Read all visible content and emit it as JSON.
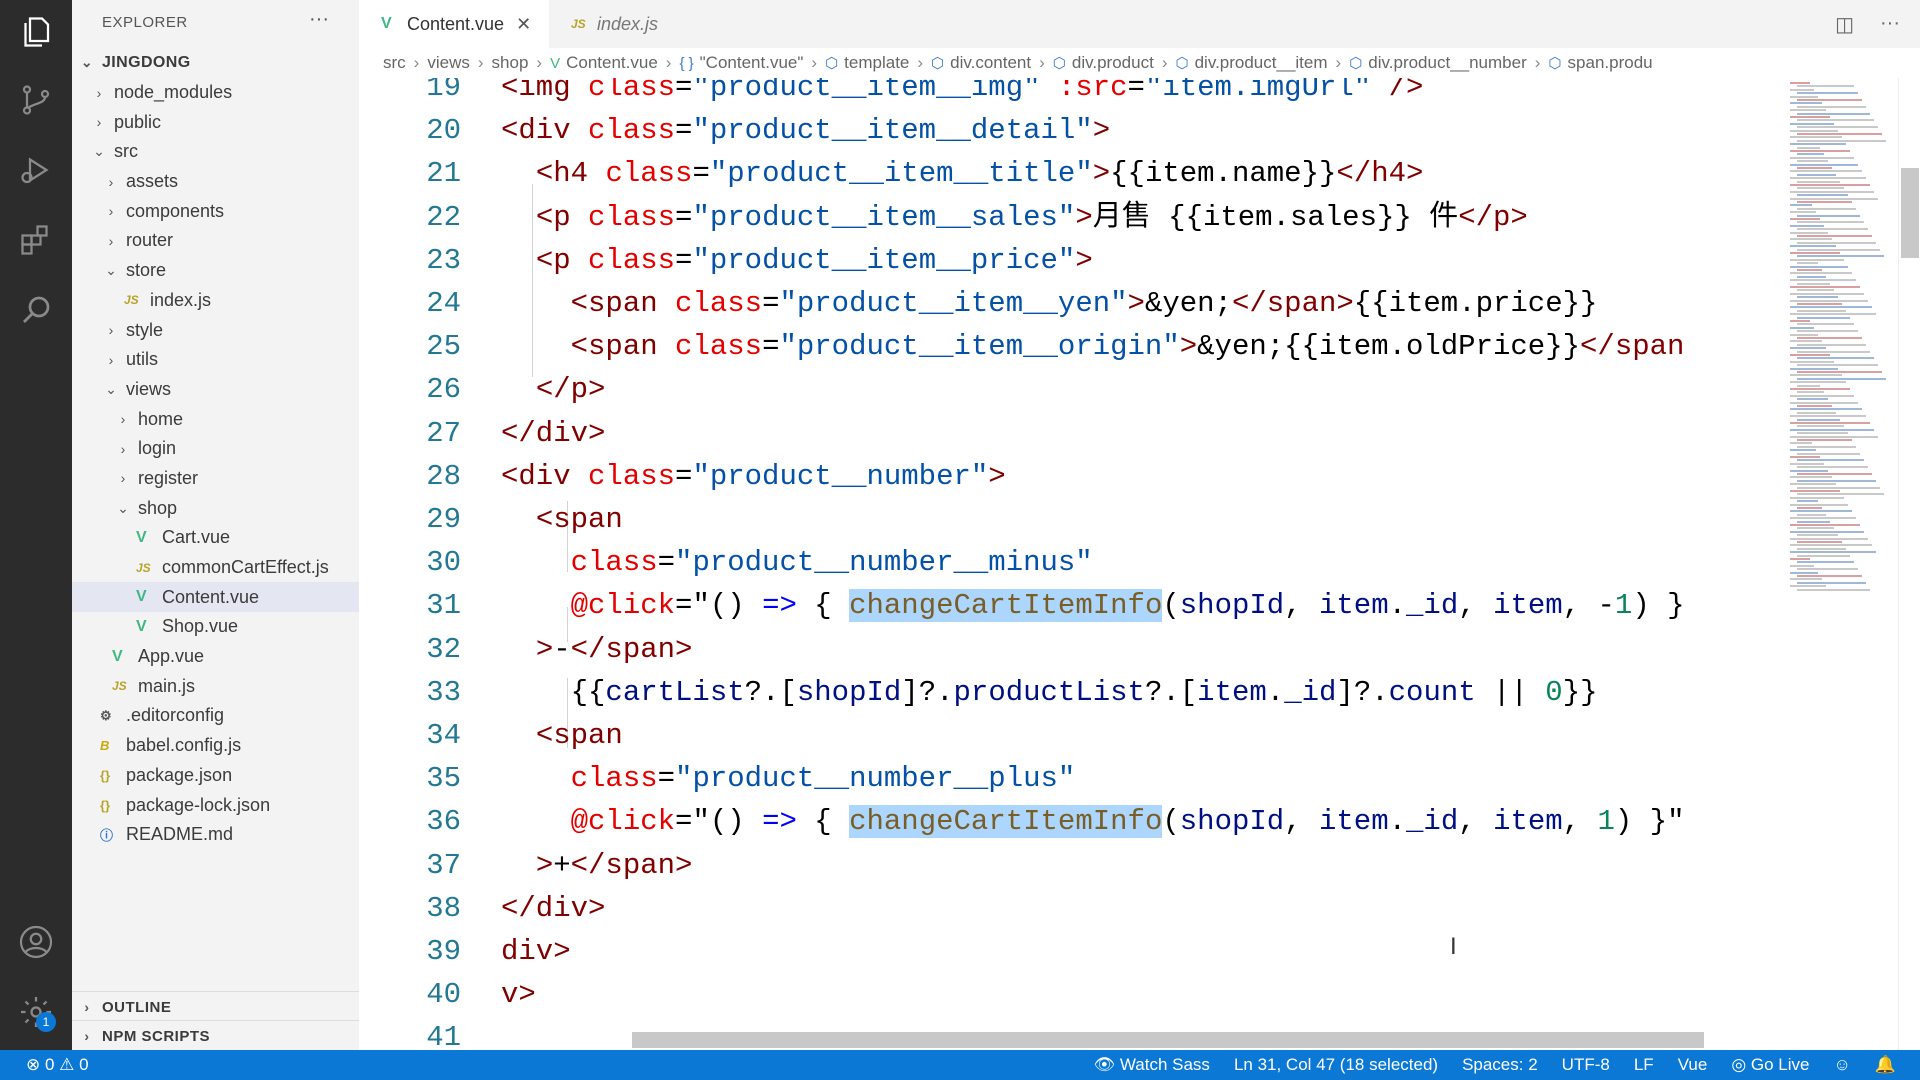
{
  "explorer": {
    "header": "EXPLORER",
    "more": "···",
    "tree": [
      {
        "label": "JINGDONG",
        "indent": 0,
        "kind": "root",
        "bold": true
      },
      {
        "label": "node_modules",
        "indent": 1,
        "kind": "folder"
      },
      {
        "label": "public",
        "indent": 1,
        "kind": "folder"
      },
      {
        "label": "src",
        "indent": 1,
        "kind": "folder-open"
      },
      {
        "label": "assets",
        "indent": 2,
        "kind": "folder"
      },
      {
        "label": "components",
        "indent": 2,
        "kind": "folder"
      },
      {
        "label": "router",
        "indent": 2,
        "kind": "folder"
      },
      {
        "label": "store",
        "indent": 2,
        "kind": "folder-open"
      },
      {
        "label": "index.js",
        "indent": 3,
        "kind": "js"
      },
      {
        "label": "style",
        "indent": 2,
        "kind": "folder"
      },
      {
        "label": "utils",
        "indent": 2,
        "kind": "folder"
      },
      {
        "label": "views",
        "indent": 2,
        "kind": "folder-open"
      },
      {
        "label": "home",
        "indent": 3,
        "kind": "folder"
      },
      {
        "label": "login",
        "indent": 3,
        "kind": "folder"
      },
      {
        "label": "register",
        "indent": 3,
        "kind": "folder"
      },
      {
        "label": "shop",
        "indent": 3,
        "kind": "folder-open"
      },
      {
        "label": "Cart.vue",
        "indent": 4,
        "kind": "vue"
      },
      {
        "label": "commonCartEffect.js",
        "indent": 4,
        "kind": "js"
      },
      {
        "label": "Content.vue",
        "indent": 4,
        "kind": "vue",
        "selected": true
      },
      {
        "label": "Shop.vue",
        "indent": 4,
        "kind": "vue"
      },
      {
        "label": "App.vue",
        "indent": 2,
        "kind": "vue"
      },
      {
        "label": "main.js",
        "indent": 2,
        "kind": "js"
      },
      {
        "label": ".editorconfig",
        "indent": 1,
        "kind": "gear"
      },
      {
        "label": "babel.config.js",
        "indent": 1,
        "kind": "babel"
      },
      {
        "label": "package.json",
        "indent": 1,
        "kind": "json"
      },
      {
        "label": "package-lock.json",
        "indent": 1,
        "kind": "json"
      },
      {
        "label": "README.md",
        "indent": 1,
        "kind": "info"
      }
    ],
    "sections": [
      "OUTLINE",
      "NPM SCRIPTS"
    ]
  },
  "tabs": [
    {
      "label": "Content.vue",
      "kind": "vue",
      "active": true
    },
    {
      "label": "index.js",
      "kind": "js",
      "active": false
    }
  ],
  "breadcrumb": [
    {
      "label": "src",
      "icon": ""
    },
    {
      "label": "views",
      "icon": ""
    },
    {
      "label": "shop",
      "icon": ""
    },
    {
      "label": "Content.vue",
      "icon": "vue"
    },
    {
      "label": "\"Content.vue\"",
      "icon": "braces"
    },
    {
      "label": "template",
      "icon": "cube"
    },
    {
      "label": "div.content",
      "icon": "cube"
    },
    {
      "label": "div.product",
      "icon": "cube"
    },
    {
      "label": "div.product__item",
      "icon": "cube"
    },
    {
      "label": "div.product__number",
      "icon": "cube"
    },
    {
      "label": "span.produ",
      "icon": "cube"
    }
  ],
  "code": [
    {
      "n": "19",
      "tokens": [
        [
          "t-tag",
          "<img "
        ],
        [
          "t-attr",
          "class"
        ],
        [
          "t-txt",
          "="
        ],
        [
          "t-str",
          "\"product__item__img\""
        ],
        [
          "t-txt",
          " "
        ],
        [
          "t-attr",
          ":src"
        ],
        [
          "t-txt",
          "="
        ],
        [
          "t-str",
          "\"item.imgUrl\""
        ],
        [
          "t-tag",
          " />"
        ]
      ]
    },
    {
      "n": "20",
      "tokens": [
        [
          "t-tag",
          "<div "
        ],
        [
          "t-attr",
          "class"
        ],
        [
          "t-txt",
          "="
        ],
        [
          "t-str",
          "\"product__item__detail\""
        ],
        [
          "t-tag",
          ">"
        ]
      ]
    },
    {
      "n": "21",
      "tokens": [
        [
          "t-txt",
          "  "
        ],
        [
          "t-tag",
          "<h4 "
        ],
        [
          "t-attr",
          "class"
        ],
        [
          "t-txt",
          "="
        ],
        [
          "t-str",
          "\"product__item__title\""
        ],
        [
          "t-tag",
          ">"
        ],
        [
          "t-txt",
          "{{item.name}}"
        ],
        [
          "t-tag",
          "</h4>"
        ]
      ]
    },
    {
      "n": "22",
      "tokens": [
        [
          "t-txt",
          "  "
        ],
        [
          "t-tag",
          "<p "
        ],
        [
          "t-attr",
          "class"
        ],
        [
          "t-txt",
          "="
        ],
        [
          "t-str",
          "\"product__item__sales\""
        ],
        [
          "t-tag",
          ">"
        ],
        [
          "t-txt",
          "月售 {{item.sales}} 件"
        ],
        [
          "t-tag",
          "</p>"
        ]
      ]
    },
    {
      "n": "23",
      "tokens": [
        [
          "t-txt",
          "  "
        ],
        [
          "t-tag",
          "<p "
        ],
        [
          "t-attr",
          "class"
        ],
        [
          "t-txt",
          "="
        ],
        [
          "t-str",
          "\"product__item__price\""
        ],
        [
          "t-tag",
          ">"
        ]
      ]
    },
    {
      "n": "24",
      "tokens": [
        [
          "t-txt",
          "    "
        ],
        [
          "t-tag",
          "<span "
        ],
        [
          "t-attr",
          "class"
        ],
        [
          "t-txt",
          "="
        ],
        [
          "t-str",
          "\"product__item__yen\""
        ],
        [
          "t-tag",
          ">"
        ],
        [
          "t-txt",
          "&yen;"
        ],
        [
          "t-tag",
          "</span>"
        ],
        [
          "t-txt",
          "{{item.price}}"
        ]
      ]
    },
    {
      "n": "25",
      "tokens": [
        [
          "t-txt",
          "    "
        ],
        [
          "t-tag",
          "<span "
        ],
        [
          "t-attr",
          "class"
        ],
        [
          "t-txt",
          "="
        ],
        [
          "t-str",
          "\"product__item__origin\""
        ],
        [
          "t-tag",
          ">"
        ],
        [
          "t-txt",
          "&yen;{{item.oldPrice}}"
        ],
        [
          "t-tag",
          "</span"
        ]
      ]
    },
    {
      "n": "26",
      "tokens": [
        [
          "t-txt",
          "  "
        ],
        [
          "t-tag",
          "</p>"
        ]
      ]
    },
    {
      "n": "27",
      "tokens": [
        [
          "t-tag",
          "</div>"
        ]
      ]
    },
    {
      "n": "28",
      "tokens": [
        [
          "t-tag",
          "<div "
        ],
        [
          "t-attr",
          "class"
        ],
        [
          "t-txt",
          "="
        ],
        [
          "t-str",
          "\"product__number\""
        ],
        [
          "t-tag",
          ">"
        ]
      ]
    },
    {
      "n": "29",
      "tokens": [
        [
          "t-txt",
          "  "
        ],
        [
          "t-tag",
          "<span"
        ]
      ]
    },
    {
      "n": "30",
      "tokens": [
        [
          "t-txt",
          "    "
        ],
        [
          "t-attr",
          "class"
        ],
        [
          "t-txt",
          "="
        ],
        [
          "t-str",
          "\"product__number__minus\""
        ]
      ]
    },
    {
      "n": "31",
      "tokens": [
        [
          "t-txt",
          "    "
        ],
        [
          "t-attr",
          "@click"
        ],
        [
          "t-txt",
          "=\"() "
        ],
        [
          "t-kw",
          "=>"
        ],
        [
          "t-txt",
          " { "
        ],
        [
          "t-fn hl",
          "changeCartItemInfo"
        ],
        [
          "t-txt",
          "("
        ],
        [
          "t-var",
          "shopId"
        ],
        [
          "t-txt",
          ", "
        ],
        [
          "t-var",
          "item"
        ],
        [
          "t-txt",
          "."
        ],
        [
          "t-var",
          "_id"
        ],
        [
          "t-txt",
          ", "
        ],
        [
          "t-var",
          "item"
        ],
        [
          "t-txt",
          ", -"
        ],
        [
          "t-num",
          "1"
        ],
        [
          "t-txt",
          ") }"
        ]
      ]
    },
    {
      "n": "32",
      "tokens": [
        [
          "t-txt",
          "  "
        ],
        [
          "t-tag",
          ">"
        ],
        [
          "t-txt",
          "-"
        ],
        [
          "t-tag",
          "</span>"
        ]
      ]
    },
    {
      "n": "33",
      "tokens": [
        [
          "t-txt",
          "    {{"
        ],
        [
          "t-var",
          "cartList"
        ],
        [
          "t-txt",
          "?.["
        ],
        [
          "t-var",
          "shopId"
        ],
        [
          "t-txt",
          "]?."
        ],
        [
          "t-var",
          "productList"
        ],
        [
          "t-txt",
          "?.["
        ],
        [
          "t-var",
          "item"
        ],
        [
          "t-txt",
          "."
        ],
        [
          "t-var",
          "_id"
        ],
        [
          "t-txt",
          "]?."
        ],
        [
          "t-var",
          "count"
        ],
        [
          "t-txt",
          " || "
        ],
        [
          "t-num",
          "0"
        ],
        [
          "t-txt",
          "}}"
        ]
      ]
    },
    {
      "n": "34",
      "tokens": [
        [
          "t-txt",
          "  "
        ],
        [
          "t-tag",
          "<span"
        ]
      ]
    },
    {
      "n": "35",
      "tokens": [
        [
          "t-txt",
          "    "
        ],
        [
          "t-attr",
          "class"
        ],
        [
          "t-txt",
          "="
        ],
        [
          "t-str",
          "\"product__number__plus\""
        ]
      ]
    },
    {
      "n": "36",
      "tokens": [
        [
          "t-txt",
          "    "
        ],
        [
          "t-attr",
          "@click"
        ],
        [
          "t-txt",
          "=\"() "
        ],
        [
          "t-kw",
          "=>"
        ],
        [
          "t-txt",
          " { "
        ],
        [
          "t-fn hl",
          "changeCartItemInfo"
        ],
        [
          "t-txt",
          "("
        ],
        [
          "t-var",
          "shopId"
        ],
        [
          "t-txt",
          ", "
        ],
        [
          "t-var",
          "item"
        ],
        [
          "t-txt",
          "."
        ],
        [
          "t-var",
          "_id"
        ],
        [
          "t-txt",
          ", "
        ],
        [
          "t-var",
          "item"
        ],
        [
          "t-txt",
          ", "
        ],
        [
          "t-num",
          "1"
        ],
        [
          "t-txt",
          ") }\""
        ]
      ]
    },
    {
      "n": "37",
      "tokens": [
        [
          "t-txt",
          "  "
        ],
        [
          "t-tag",
          ">"
        ],
        [
          "t-txt",
          "+"
        ],
        [
          "t-tag",
          "</span>"
        ]
      ]
    },
    {
      "n": "38",
      "tokens": [
        [
          "t-tag",
          "</div>"
        ]
      ]
    },
    {
      "n": "39",
      "tokens": [
        [
          "t-tag",
          "div>"
        ]
      ]
    },
    {
      "n": "40",
      "tokens": [
        [
          "t-tag",
          "v>"
        ]
      ]
    },
    {
      "n": "41",
      "tokens": []
    }
  ],
  "statusbar": {
    "errors": "0",
    "warnings": "0",
    "watch_sass": "Watch Sass",
    "position": "Ln 31, Col 47 (18 selected)",
    "spaces": "Spaces: 2",
    "encoding": "UTF-8",
    "eol": "LF",
    "language": "Vue",
    "go_live": "Go Live"
  },
  "activity_badge": "1",
  "colors": {
    "statusbar": "#0a78d4",
    "activitybar": "#2c2c2c",
    "sidebar": "#f3f3f3",
    "selection": "#add6ff"
  }
}
